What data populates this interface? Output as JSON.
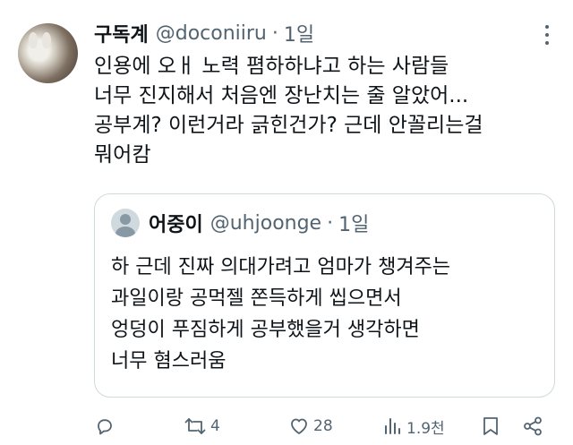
{
  "tweet": {
    "author_name": "구독계",
    "handle": "@doconiiru",
    "separator": "·",
    "time": "1일",
    "lines": [
      "인용에 오ㅐ 노력 폄하하냐고 하는 사람들",
      "너무 진지해서 처음엔 장난치는 줄 알았어...",
      "공부계? 이런거라 긁힌건가? 근데 안꼴리는걸",
      "뭐어캄"
    ]
  },
  "quoted": {
    "author_name": "어중이",
    "handle": "@uhjoonge",
    "separator": "·",
    "time": "1일",
    "lines": [
      "하 근데 진짜 의대가려고 엄마가 챙겨주는",
      "과일이랑 공먹젤 쫀득하게 씹으면서",
      "엉덩이 푸짐하게 공부했을거 생각하면",
      "너무 혐스러움"
    ]
  },
  "actions": {
    "retweets": "4",
    "likes": "28",
    "views": "1.9천"
  },
  "icons": {
    "reply": "reply-icon",
    "retweet": "retweet-icon",
    "like": "heart-icon",
    "views": "views-icon",
    "bookmark": "bookmark-icon",
    "share": "share-icon",
    "more": "more-icon"
  },
  "colors": {
    "text": "#0f1419",
    "secondary": "#536471",
    "border": "#cfd9de"
  }
}
